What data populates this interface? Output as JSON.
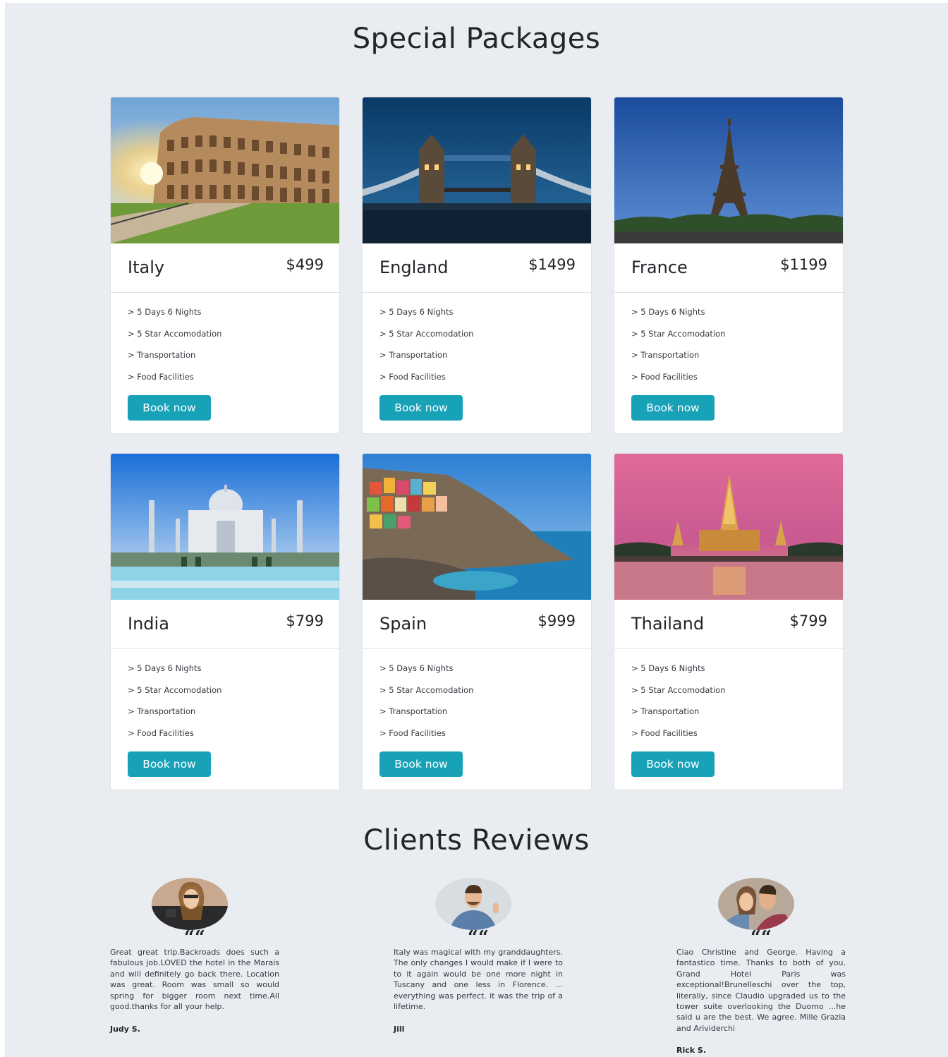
{
  "packages": {
    "title": "Special Packages",
    "cards": [
      {
        "country": "Italy",
        "price": "$499",
        "features": [
          "> 5 Days 6 Nights",
          "> 5 Star Accomodation",
          "> Transportation",
          "> Food Facilities"
        ],
        "button": "Book now",
        "image": "colosseum-photo"
      },
      {
        "country": "England",
        "price": "$1499",
        "features": [
          "> 5 Days 6 Nights",
          "> 5 Star Accomodation",
          "> Transportation",
          "> Food Facilities"
        ],
        "button": "Book now",
        "image": "tower-bridge-photo"
      },
      {
        "country": "France",
        "price": "$1199",
        "features": [
          "> 5 Days 6 Nights",
          "> 5 Star Accomodation",
          "> Transportation",
          "> Food Facilities"
        ],
        "button": "Book now",
        "image": "eiffel-tower-photo"
      },
      {
        "country": "India",
        "price": "$799",
        "features": [
          "> 5 Days 6 Nights",
          "> 5 Star Accomodation",
          "> Transportation",
          "> Food Facilities"
        ],
        "button": "Book now",
        "image": "taj-mahal-photo"
      },
      {
        "country": "Spain",
        "price": "$999",
        "features": [
          "> 5 Days 6 Nights",
          "> 5 Star Accomodation",
          "> Transportation",
          "> Food Facilities"
        ],
        "button": "Book now",
        "image": "coastal-village-photo"
      },
      {
        "country": "Thailand",
        "price": "$799",
        "features": [
          "> 5 Days 6 Nights",
          "> 5 Star Accomodation",
          "> Transportation",
          "> Food Facilities"
        ],
        "button": "Book now",
        "image": "temple-photo"
      }
    ]
  },
  "reviews": {
    "title": "Clients Reviews",
    "quote_mark": "““",
    "items": [
      {
        "text": "Great great trip.Backroads does such a fabulous job.LOVED the hotel in the Marais and will definitely go back there. Location was great. Room was small so would spring for bigger room next time.All good.thanks for all your help.",
        "author": "Judy S."
      },
      {
        "text": "Italy was magical with my granddaughters. The only changes I would make if I were to to it again would be one more night in Tuscany and one less in Florence. ... everything was perfect. it was the trip of a lifetime.",
        "author": "Jill"
      },
      {
        "text": "Ciao Christine and George. Having a fantastico time. Thanks to both of you. Grand Hotel Paris was exceptional!Brunelleschi over the top, literally, since Claudio upgraded us to the tower suite overlooking the Duomo ...he said u are the best. We agree. Mille Grazia and Arividerchi",
        "author": "Rick S."
      }
    ]
  },
  "colors": {
    "page_bg": "#e9ecf1",
    "button": "#17a2b8",
    "card_bg": "#ffffff"
  }
}
